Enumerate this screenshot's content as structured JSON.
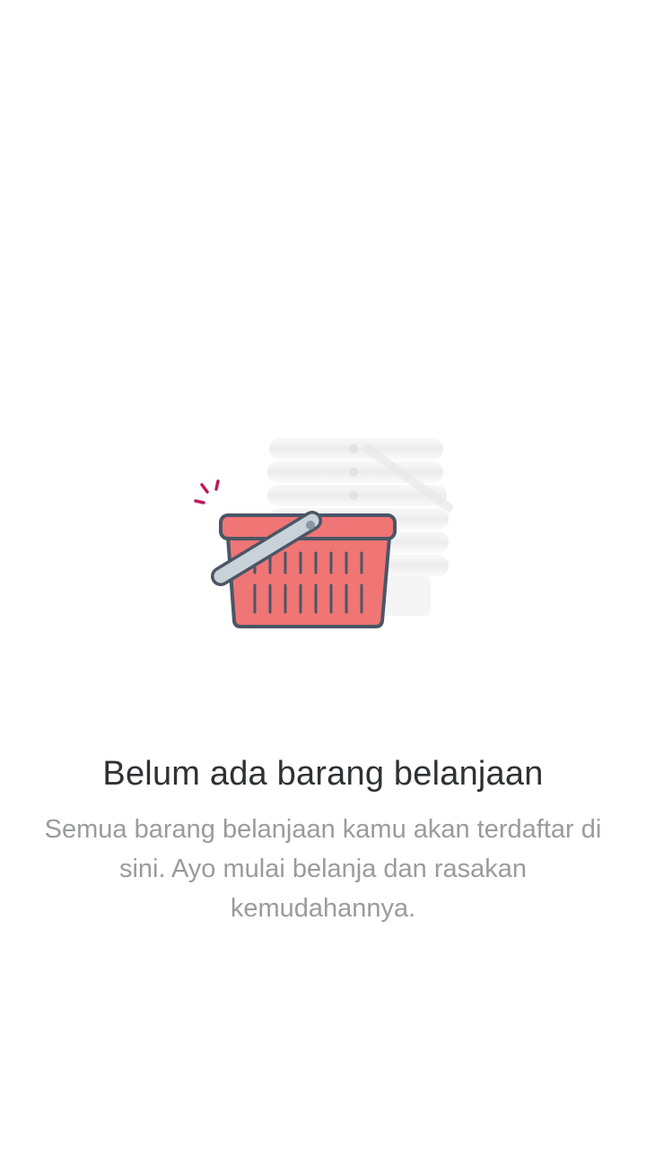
{
  "empty_state": {
    "illustration": {
      "icon": "shopping-basket-icon",
      "colors": {
        "basket": "#f07575",
        "outline": "#4a5666",
        "handle": "#c9d2d8",
        "spark": "#c2185b",
        "stack": "#f1f1f1"
      }
    },
    "title": "Belum ada barang belanjaan",
    "description": "Semua barang belanjaan kamu akan terdaftar di sini. Ayo mulai belanja dan rasakan kemudahannya."
  }
}
